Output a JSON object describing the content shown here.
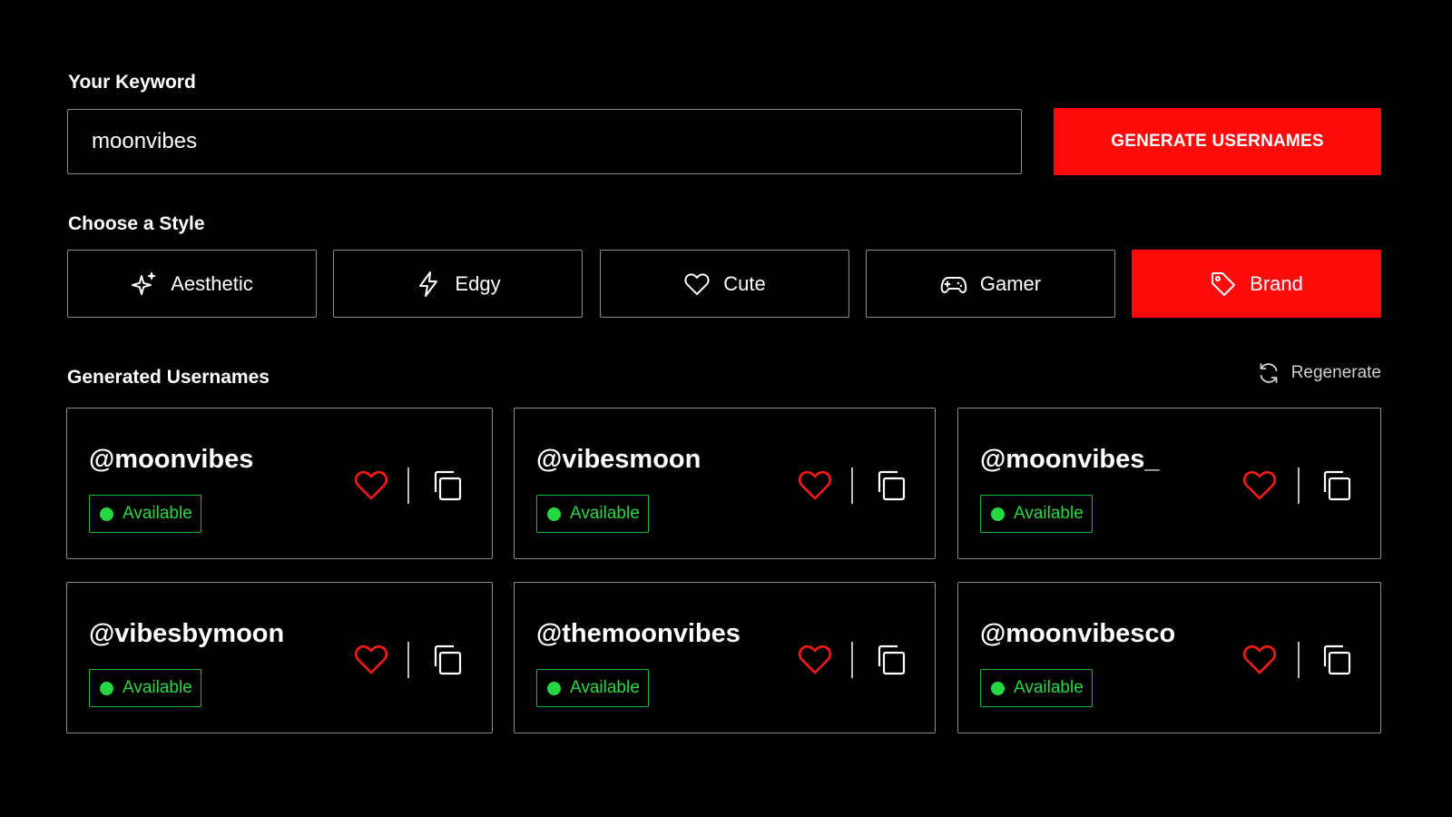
{
  "keyword": {
    "label": "Your Keyword",
    "value": "moonvibes"
  },
  "generate_button": "GENERATE USERNAMES",
  "styles": {
    "label": "Choose a Style",
    "items": [
      {
        "label": "Aesthetic",
        "icon": "sparkles-icon",
        "selected": false
      },
      {
        "label": "Edgy",
        "icon": "lightning-icon",
        "selected": false
      },
      {
        "label": "Cute",
        "icon": "heart-icon",
        "selected": false
      },
      {
        "label": "Gamer",
        "icon": "gamepad-icon",
        "selected": false
      },
      {
        "label": "Brand",
        "icon": "tag-icon",
        "selected": true
      }
    ]
  },
  "results": {
    "title": "Generated Usernames",
    "regenerate_label": "Regenerate",
    "items": [
      {
        "username": "@moonvibes",
        "status": "Available"
      },
      {
        "username": "@vibesmoon",
        "status": "Available"
      },
      {
        "username": "@moonvibes_",
        "status": "Available"
      },
      {
        "username": "@vibesbymoon",
        "status": "Available"
      },
      {
        "username": "@themoonvibes",
        "status": "Available"
      },
      {
        "username": "@moonvibesco",
        "status": "Available"
      }
    ]
  },
  "colors": {
    "background": "#000000",
    "accent": "#ff0a0a",
    "available": "#25d944",
    "border": "#8a8a8a"
  }
}
